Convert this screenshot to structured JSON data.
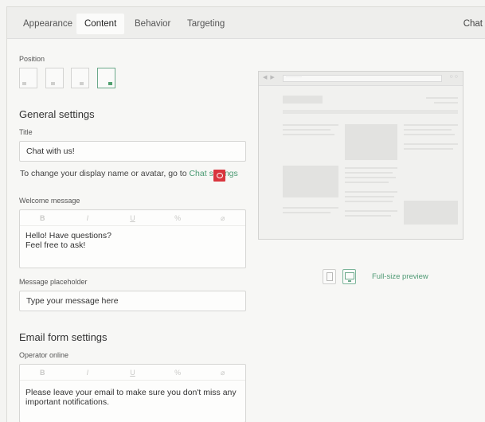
{
  "tabs": [
    {
      "label": "Appearance",
      "active": false
    },
    {
      "label": "Content",
      "active": true
    },
    {
      "label": "Behavior",
      "active": false
    },
    {
      "label": "Targeting",
      "active": false
    }
  ],
  "tab_right": "Chat",
  "position": {
    "label": "Position",
    "options": [
      "bottom-left",
      "bottom-center-left",
      "bottom-center-right",
      "bottom-right"
    ],
    "selected": "bottom-right"
  },
  "general": {
    "heading": "General settings",
    "title_label": "Title",
    "title_value": "Chat with us!",
    "hint_prefix": "To change your display name or avatar, go to ",
    "hint_link": "Chat settings",
    "welcome_label": "Welcome message",
    "welcome_text": "Hello! Have questions?\nFeel free to ask!",
    "placeholder_label": "Message placeholder",
    "placeholder_value": "Type your message here"
  },
  "toolbar": {
    "bold": "B",
    "italic": "I",
    "underline": "U",
    "link": "%",
    "clear": "⌀"
  },
  "email_form": {
    "heading": "Email form settings",
    "operator_online_label": "Operator online",
    "operator_online_text": "Please leave your email to make sure you don't miss any important notifications."
  },
  "preview": {
    "url_text": "··········",
    "full_size_label": "Full-size preview",
    "device_selected": "desktop"
  },
  "colors": {
    "accent": "#4f9a74",
    "chat_button": "#d9363e"
  }
}
